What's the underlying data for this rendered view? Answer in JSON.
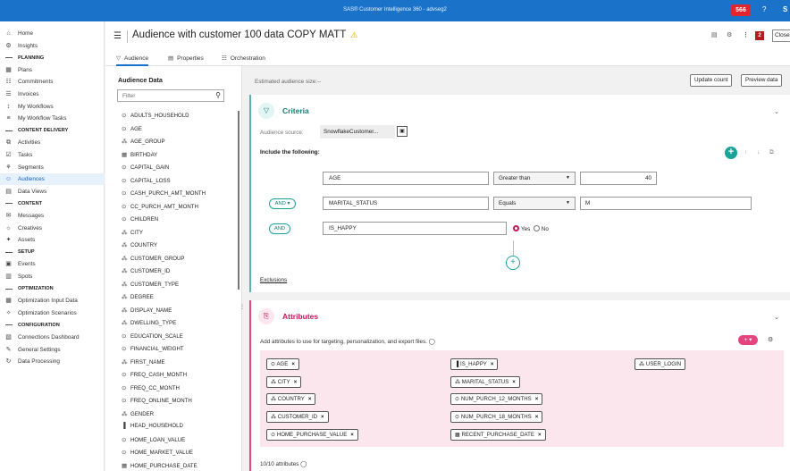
{
  "app": {
    "title": "SAS® Customer Intelligence 360 - advseg2",
    "notif_count": "566",
    "help_icon": "?",
    "user_initial": "S"
  },
  "nav": {
    "items": [
      {
        "key": "home",
        "label": "Home",
        "icon": "⌂"
      },
      {
        "key": "insights",
        "label": "Insights",
        "icon": "⚙"
      },
      {
        "key": "sec_planning",
        "label": "PLANNING",
        "section": true
      },
      {
        "key": "plans",
        "label": "Plans",
        "icon": "▦"
      },
      {
        "key": "commitments",
        "label": "Commitments",
        "icon": "☷"
      },
      {
        "key": "invoices",
        "label": "Invoices",
        "icon": "☰"
      },
      {
        "key": "my_workflows",
        "label": "My Workflows",
        "icon": "↕"
      },
      {
        "key": "my_workflow_tasks",
        "label": "My Workflow Tasks",
        "icon": "≡"
      },
      {
        "key": "sec_content_delivery",
        "label": "CONTENT DELIVERY",
        "section": true
      },
      {
        "key": "activities",
        "label": "Activities",
        "icon": "⧉"
      },
      {
        "key": "tasks",
        "label": "Tasks",
        "icon": "☑"
      },
      {
        "key": "segments",
        "label": "Segments",
        "icon": "⚘"
      },
      {
        "key": "audiences",
        "label": "Audiences",
        "icon": "☺",
        "active": true
      },
      {
        "key": "data_views",
        "label": "Data Views",
        "icon": "▤"
      },
      {
        "key": "sec_content",
        "label": "CONTENT",
        "section": true
      },
      {
        "key": "messages",
        "label": "Messages",
        "icon": "✉"
      },
      {
        "key": "creatives",
        "label": "Creatives",
        "icon": "☼"
      },
      {
        "key": "assets",
        "label": "Assets",
        "icon": "✦"
      },
      {
        "key": "sec_setup",
        "label": "SETUP",
        "section": true
      },
      {
        "key": "events",
        "label": "Events",
        "icon": "▣"
      },
      {
        "key": "spots",
        "label": "Spots",
        "icon": "▥"
      },
      {
        "key": "sec_optimization",
        "label": "OPTIMIZATION",
        "section": true
      },
      {
        "key": "opt_input",
        "label": "Optimization Input Data",
        "icon": "▦"
      },
      {
        "key": "opt_scen",
        "label": "Optimization Scenarios",
        "icon": "✧"
      },
      {
        "key": "sec_configuration",
        "label": "CONFIGURATION",
        "section": true
      },
      {
        "key": "connections",
        "label": "Connections Dashboard",
        "icon": "▧"
      },
      {
        "key": "general_settings",
        "label": "General Settings",
        "icon": "✎"
      },
      {
        "key": "data_processing",
        "label": "Data Processing",
        "icon": "↻"
      }
    ]
  },
  "header": {
    "title": "Audience with customer 100 data COPY MATT",
    "warn": "⚠",
    "badge": "2",
    "close_label": "Close"
  },
  "tabs": [
    {
      "label": "Audience",
      "icon": "▽"
    },
    {
      "label": "Properties",
      "icon": "▤"
    },
    {
      "label": "Orchestration",
      "icon": "☷"
    }
  ],
  "left_panel": {
    "title": "Audience Data",
    "filter_placeholder": "Filter",
    "variables": [
      {
        "name": "ADULTS_HOUSEHOLD",
        "icon": "⊙"
      },
      {
        "name": "AGE",
        "icon": "⊙"
      },
      {
        "name": "AGE_GROUP",
        "icon": "⁂"
      },
      {
        "name": "BIRTHDAY",
        "icon": "▦"
      },
      {
        "name": "CAPITAL_GAIN",
        "icon": "⊙"
      },
      {
        "name": "CAPITAL_LOSS",
        "icon": "⊙"
      },
      {
        "name": "CASH_PURCH_AMT_MONTH",
        "icon": "⊙"
      },
      {
        "name": "CC_PURCH_AMT_MONTH",
        "icon": "⊙"
      },
      {
        "name": "CHILDREN",
        "icon": "⊙"
      },
      {
        "name": "CITY",
        "icon": "⁂"
      },
      {
        "name": "COUNTRY",
        "icon": "⁂"
      },
      {
        "name": "CUSTOMER_GROUP",
        "icon": "⁂"
      },
      {
        "name": "CUSTOMER_ID",
        "icon": "⁂"
      },
      {
        "name": "CUSTOMER_TYPE",
        "icon": "⁂"
      },
      {
        "name": "DEGREE",
        "icon": "⁂"
      },
      {
        "name": "DISPLAY_NAME",
        "icon": "⁂"
      },
      {
        "name": "DWELLING_TYPE",
        "icon": "⁂"
      },
      {
        "name": "EDUCATION_SCALE",
        "icon": "⊙"
      },
      {
        "name": "FINANCIAL_WEIGHT",
        "icon": "⊙"
      },
      {
        "name": "FIRST_NAME",
        "icon": "⁂"
      },
      {
        "name": "FREQ_CASH_MONTH",
        "icon": "⊙"
      },
      {
        "name": "FREQ_CC_MONTH",
        "icon": "⊙"
      },
      {
        "name": "FREQ_ONLINE_MONTH",
        "icon": "⊙"
      },
      {
        "name": "GENDER",
        "icon": "⁂"
      },
      {
        "name": "HEAD_HOUSEHOLD",
        "icon": "▐"
      },
      {
        "name": "HOME_LOAN_VALUE",
        "icon": "⊙"
      },
      {
        "name": "HOME_MARKET_VALUE",
        "icon": "⊙"
      },
      {
        "name": "HOME_PURCHASE_DATE",
        "icon": "▦"
      }
    ]
  },
  "content": {
    "estimated_label": "Estimated audience size:--",
    "update_count_label": "Update count",
    "preview_label": "Preview data",
    "criteria": {
      "title": "Criteria",
      "icon": "▽",
      "source_label": "Audience source:",
      "source_value": "SnowflakeCustomer...",
      "include_label": "Include the following:",
      "rows": [
        {
          "field": "AGE",
          "operator": "Greater than",
          "value": "40"
        },
        {
          "connector": "AND ▾",
          "field": "MARITAL_STATUS",
          "operator": "Equals",
          "value": "M"
        },
        {
          "connector": "AND",
          "field": "IS_HAPPY",
          "yes_label": "Yes",
          "no_label": "No"
        }
      ],
      "exclusions_label": "Exclusions"
    },
    "attributes": {
      "title": "Attributes",
      "icon": "⎘",
      "description": "Add attributes to use for targeting, personalization, and export files.",
      "chips": [
        {
          "label": "AGE",
          "icon": "⊙",
          "removable": true
        },
        {
          "label": "IS_HAPPY",
          "icon": "▐",
          "removable": true
        },
        {
          "label": "USER_LOGIN",
          "icon": "⁂",
          "removable": false
        },
        {
          "label": "CITY",
          "icon": "⁂",
          "removable": true
        },
        {
          "label": "MARITAL_STATUS",
          "icon": "⁂",
          "removable": true
        },
        {
          "label": "COUNTRY",
          "icon": "⁂",
          "removable": true
        },
        {
          "label": "NUM_PURCH_12_MONTHS",
          "icon": "⊙",
          "removable": true
        },
        {
          "label": "CUSTOMER_ID",
          "icon": "⁂",
          "removable": true
        },
        {
          "label": "NUM_PURCH_18_MONTHS",
          "icon": "⊙",
          "removable": true
        },
        {
          "label": "HOME_PURCHASE_VALUE",
          "icon": "⊙",
          "removable": true
        },
        {
          "label": "RECENT_PURCHASE_DATE",
          "icon": "▦",
          "removable": true
        }
      ],
      "count_label": "10/10 attributes"
    }
  }
}
